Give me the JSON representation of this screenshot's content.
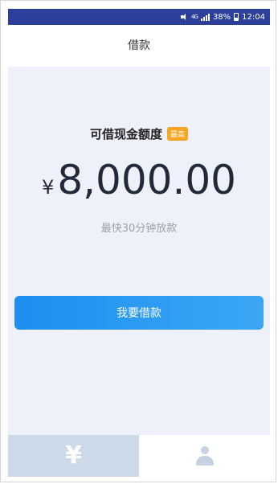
{
  "status_bar": {
    "network": "4G",
    "battery": "38%",
    "time": "12:04"
  },
  "header": {
    "title": "借款"
  },
  "credit": {
    "title": "可借现金额度",
    "badge": "最高",
    "currency": "¥",
    "amount": "8,000.00",
    "subtext": "最快30分钟放款"
  },
  "actions": {
    "borrow_label": "我要借款"
  },
  "tabs": [
    {
      "icon": "yen-icon",
      "active": true
    },
    {
      "icon": "person-icon",
      "active": false
    }
  ],
  "colors": {
    "status_bar": "#2b3f9b",
    "badge": "#f5a623",
    "button": "#1e8ff0",
    "active_tab": "#ccd9e8"
  }
}
